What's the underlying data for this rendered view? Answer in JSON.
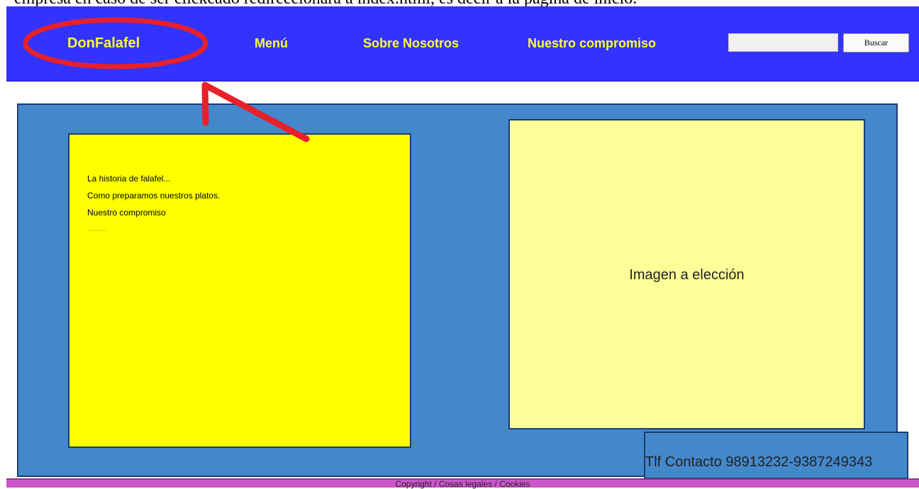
{
  "caption": "empresa en caso de ser clickeado redireccionara a index.html, es decir a la pagina de inicio.",
  "navbar": {
    "brand": "DonFalafel",
    "links": [
      "Menú",
      "Sobre Nosotros",
      "Nuestro compromiso"
    ],
    "search": {
      "value": "",
      "placeholder": "",
      "button_label": "Buscar"
    }
  },
  "content": {
    "text_items": [
      "La historia de falafel...",
      "Como preparamos nuestros platos.",
      "Nuestro compromiso",
      "........"
    ],
    "image_placeholder": "Imagen a elección"
  },
  "contact": {
    "text": "Tlf Contacto 98913232-9387249343"
  },
  "footer": {
    "text": "Copyright / Cosas legales / Cookies"
  },
  "colors": {
    "navbar_bg": "#3333ff",
    "nav_text": "#ffff33",
    "main_bg": "#4488cc",
    "text_box_bg": "#ffff00",
    "image_box_bg": "#ffff99",
    "footer_bg": "#cc55cc",
    "annotation": "#e8202a"
  },
  "annotation": {
    "type": "red-ellipse-and-arrow",
    "target": "brand-logo"
  }
}
